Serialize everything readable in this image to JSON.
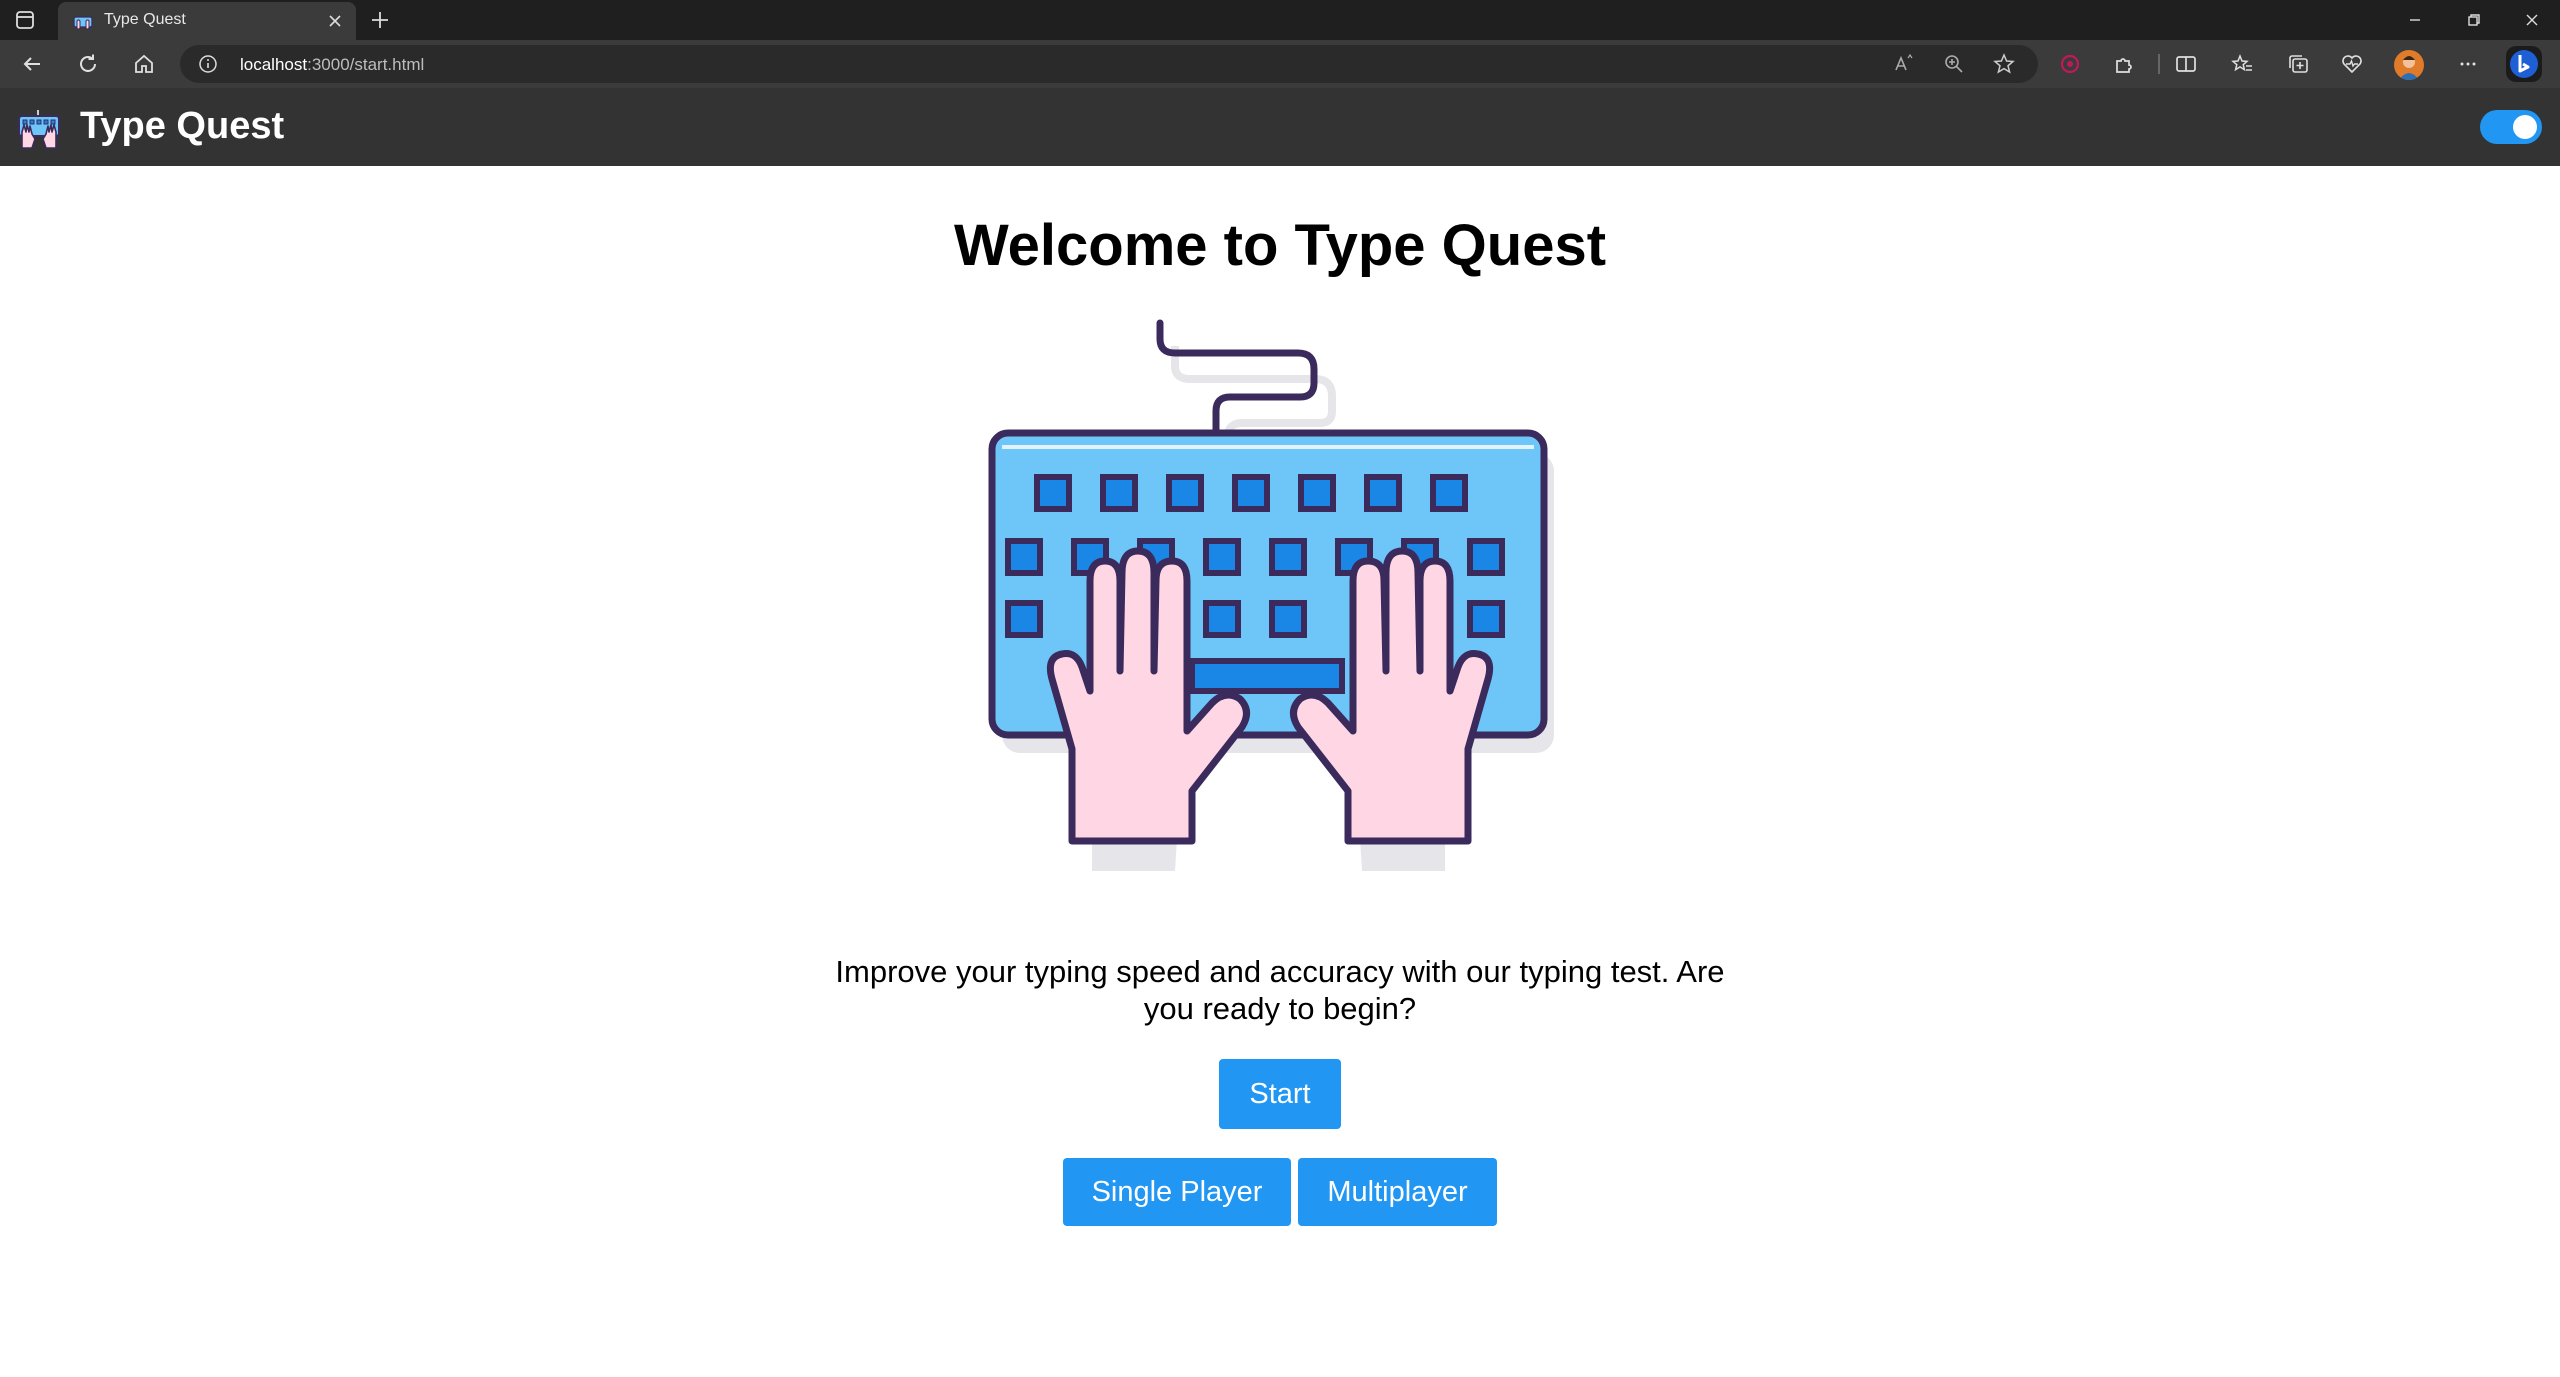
{
  "browser": {
    "tab": {
      "title": "Type Quest",
      "favicon": "keyboard-hands-icon"
    },
    "address_bar": {
      "host": "localhost",
      "path": ":3000/start.html"
    },
    "toolbar_icons": [
      "back-icon",
      "refresh-icon",
      "home-icon",
      "read-aloud-icon",
      "zoom-icon",
      "favorite-star-icon",
      "extension-icon",
      "extensions-puzzle-icon",
      "split-screen-icon",
      "favorites-icon",
      "collections-icon",
      "performance-icon",
      "profile-avatar",
      "more-icon",
      "copilot-icon"
    ],
    "window_controls": [
      "minimize-icon",
      "restore-icon",
      "close-icon"
    ]
  },
  "app": {
    "header": {
      "title": "Type Quest",
      "logo": "keyboard-hands-icon",
      "theme_toggle_on": true
    },
    "main": {
      "title": "Welcome to Type Quest",
      "hero": "keyboard-with-hands-illustration",
      "intro_line1": "Improve your typing speed and accuracy with our typing test. Are",
      "intro_line2": "you ready to begin?",
      "buttons": {
        "start": "Start",
        "single_player": "Single Player",
        "multiplayer": "Multiplayer"
      }
    }
  },
  "colors": {
    "header_bg": "#333333",
    "button_bg": "#2196f3",
    "keyboard_body": "#6ec6f8",
    "key_fill": "#1a86e6",
    "outline": "#3b2a5c",
    "hand_fill": "#ffd6e4"
  }
}
